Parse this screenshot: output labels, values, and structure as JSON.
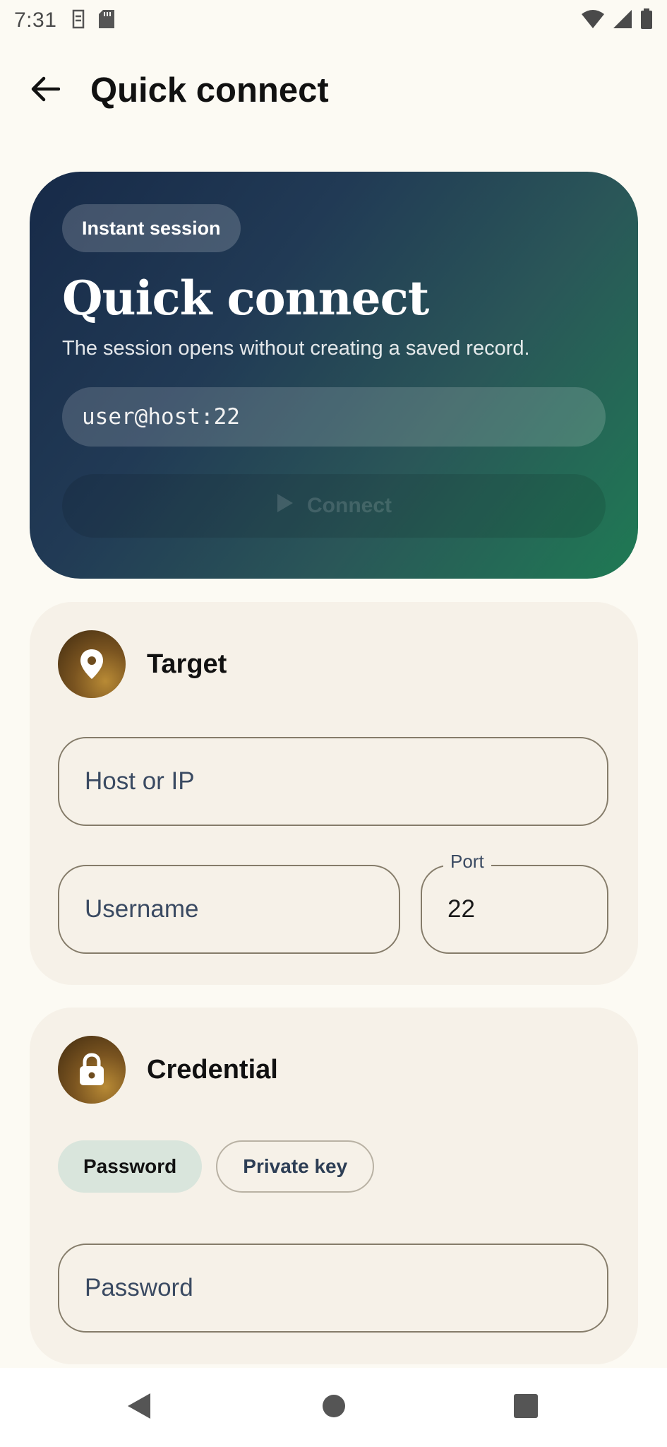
{
  "status_bar": {
    "time": "7:31",
    "left_icons": [
      "sim-icon",
      "sd-card-icon"
    ],
    "right_icons": [
      "wifi-icon",
      "signal-icon",
      "battery-icon"
    ]
  },
  "app_bar": {
    "back_icon": "arrow-left-icon",
    "title": "Quick connect"
  },
  "hero": {
    "chip": "Instant session",
    "title": "Quick connect",
    "subtitle": "The session opens without creating a saved record.",
    "preview": "user@host:22",
    "connect_label": "Connect",
    "connect_icon": "play-icon",
    "gradient": [
      "#172a48",
      "#1f7a54"
    ]
  },
  "target_card": {
    "title": "Target",
    "icon": "location-pin-icon",
    "host_placeholder": "Host or IP",
    "username_placeholder": "Username",
    "port_label": "Port",
    "port_value": "22"
  },
  "credential_card": {
    "title": "Credential",
    "icon": "lock-icon",
    "methods": [
      {
        "label": "Password",
        "selected": true
      },
      {
        "label": "Private key",
        "selected": false
      }
    ],
    "password_placeholder": "Password"
  },
  "nav_bar": {
    "icons": [
      "back-triangle-icon",
      "home-circle-icon",
      "recents-square-icon"
    ]
  },
  "colors": {
    "background": "#fcfaf3",
    "card": "#f6f1e8",
    "accent_icon": "#7a5420",
    "selected_chip": "#d9e5dc",
    "field_outline": "#857c6a"
  }
}
